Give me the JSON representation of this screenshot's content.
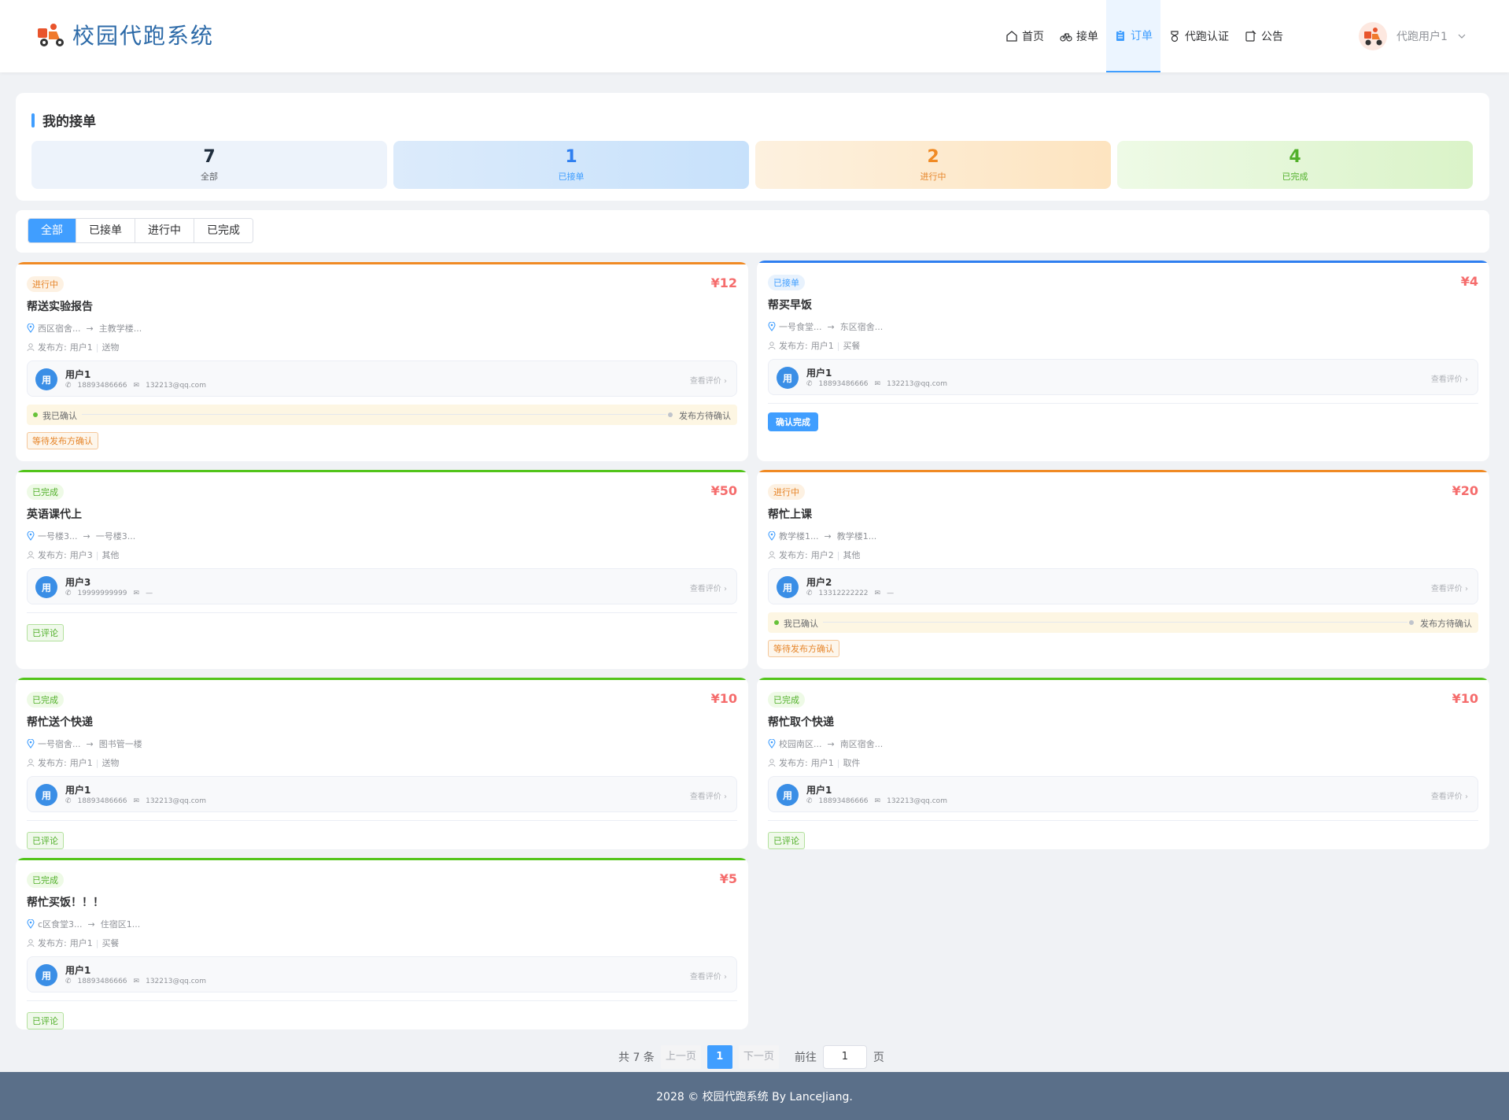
{
  "app": {
    "title": "校园代跑系统"
  },
  "nav": [
    {
      "label": "首页"
    },
    {
      "label": "接单"
    },
    {
      "label": "订单"
    },
    {
      "label": "代跑认证"
    },
    {
      "label": "公告"
    }
  ],
  "user": {
    "name": "代跑用户1"
  },
  "panel": {
    "title": "我的接单"
  },
  "stats": [
    {
      "num": "7",
      "label": "全部"
    },
    {
      "num": "1",
      "label": "已接单"
    },
    {
      "num": "2",
      "label": "进行中"
    },
    {
      "num": "4",
      "label": "已完成"
    }
  ],
  "tabs": [
    "全部",
    "已接单",
    "进行中",
    "已完成"
  ],
  "orders": [
    {
      "status": "进行中",
      "price": "¥12",
      "title": "帮送实验报告",
      "from": "西区宿舍...",
      "to": "主教学楼...",
      "publisher_label": "发布方:",
      "publisher": "用户1",
      "type": "送物",
      "pub_avatar": "用",
      "pub_name": "用户1",
      "pub_phone": "18893486666",
      "pub_email": "132213@qq.com",
      "review": "查看评价 ›",
      "prog_left": "我已确认",
      "prog_right": "发布方待确认",
      "tag": "等待发布方确认"
    },
    {
      "status": "已接单",
      "price": "¥4",
      "title": "帮买早饭",
      "from": "一号食堂...",
      "to": "东区宿舍...",
      "publisher_label": "发布方:",
      "publisher": "用户1",
      "type": "买餐",
      "pub_avatar": "用",
      "pub_name": "用户1",
      "pub_phone": "18893486666",
      "pub_email": "132213@qq.com",
      "review": "查看评价 ›",
      "btn": "确认完成"
    },
    {
      "status": "已完成",
      "price": "¥50",
      "title": "英语课代上",
      "from": "一号楼3...",
      "to": "一号楼3...",
      "publisher_label": "发布方:",
      "publisher": "用户3",
      "type": "其他",
      "pub_avatar": "用",
      "pub_name": "用户3",
      "pub_phone": "19999999999",
      "pub_email": "—",
      "review": "查看评价 ›",
      "tag": "已评论"
    },
    {
      "status": "进行中",
      "price": "¥20",
      "title": "帮忙上课",
      "from": "教学楼1...",
      "to": "教学楼1...",
      "publisher_label": "发布方:",
      "publisher": "用户2",
      "type": "其他",
      "pub_avatar": "用",
      "pub_name": "用户2",
      "pub_phone": "13312222222",
      "pub_email": "—",
      "review": "查看评价 ›",
      "prog_left": "我已确认",
      "prog_right": "发布方待确认",
      "tag": "等待发布方确认"
    },
    {
      "status": "已完成",
      "price": "¥10",
      "title": "帮忙送个快递",
      "from": "一号宿舍...",
      "to": "图书管一楼",
      "publisher_label": "发布方:",
      "publisher": "用户1",
      "type": "送物",
      "pub_avatar": "用",
      "pub_name": "用户1",
      "pub_phone": "18893486666",
      "pub_email": "132213@qq.com",
      "review": "查看评价 ›",
      "tag": "已评论"
    },
    {
      "status": "已完成",
      "price": "¥10",
      "title": "帮忙取个快递",
      "from": "校园南区...",
      "to": "南区宿舍...",
      "publisher_label": "发布方:",
      "publisher": "用户1",
      "type": "取件",
      "pub_avatar": "用",
      "pub_name": "用户1",
      "pub_phone": "18893486666",
      "pub_email": "132213@qq.com",
      "review": "查看评价 ›",
      "tag": "已评论"
    },
    {
      "status": "已完成",
      "price": "¥5",
      "title": "帮忙买饭！！！",
      "from": "c区食堂3...",
      "to": "住宿区1...",
      "publisher_label": "发布方:",
      "publisher": "用户1",
      "type": "买餐",
      "pub_avatar": "用",
      "pub_name": "用户1",
      "pub_phone": "18893486666",
      "pub_email": "132213@qq.com",
      "review": "查看评价 ›",
      "tag": "已评论"
    }
  ],
  "pager": {
    "total": "共 7 条",
    "prev": "上一页",
    "current": "1",
    "next": "下一页",
    "goto": "前往",
    "goto_value": "1",
    "page_unit": "页"
  },
  "footer": {
    "text": "2028 © 校园代跑系统 By LanceJiang."
  },
  "colors": {
    "accent": "#409eff",
    "orange": "#f08a24",
    "green": "#67c23a",
    "blue": "#2f7ff0",
    "price": "#f56c6c"
  }
}
